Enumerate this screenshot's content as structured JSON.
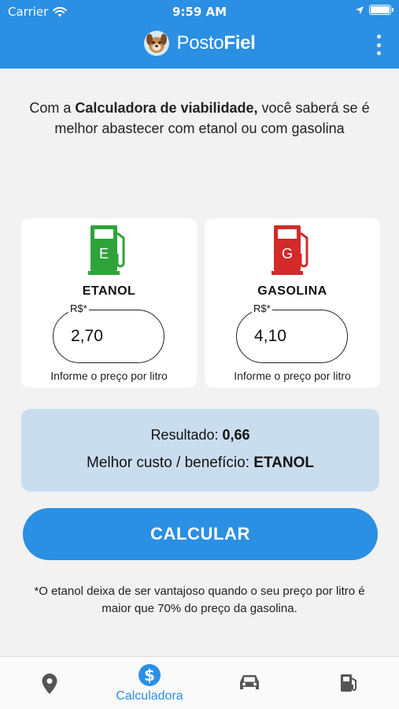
{
  "status_bar": {
    "carrier": "Carrier",
    "time": "9:59 AM"
  },
  "header": {
    "logo_light": "Posto",
    "logo_bold": "Fiel"
  },
  "intro": {
    "prefix": "Com a ",
    "highlight": "Calculadora de viabilidade,",
    "suffix": " você saberá se é melhor abastecer com etanol ou com gasolina"
  },
  "cards": [
    {
      "id": "etanol",
      "title": "ETANOL",
      "pump_letter": "E",
      "pump_color": "#2fa33a",
      "currency_label": "R$*",
      "value": "2,70",
      "hint": "Informe o preço por litro"
    },
    {
      "id": "gasolina",
      "title": "GASOLINA",
      "pump_letter": "G",
      "pump_color": "#d32a2a",
      "currency_label": "R$*",
      "value": "4,10",
      "hint": "Informe o preço por litro"
    }
  ],
  "result": {
    "label": "Resultado: ",
    "value": "0,66",
    "best_label": "Melhor custo / benefício: ",
    "best_value": "ETANOL"
  },
  "calc_button": "CALCULAR",
  "note": "*O etanol deixa de ser vantajoso quando o seu preço por litro é maior que 70% do preço da gasolina.",
  "tabbar": {
    "active_index": 1,
    "active_label": "Calculadora",
    "icons": [
      "location-pin-icon",
      "dollar-icon",
      "car-icon",
      "fuel-pump-icon"
    ]
  },
  "colors": {
    "primary": "#2b8fe3",
    "result_bg": "#c9ddef",
    "inactive_icon": "#555555"
  }
}
